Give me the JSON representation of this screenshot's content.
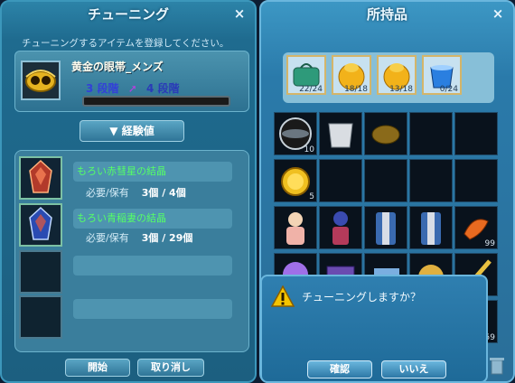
{
  "tuning": {
    "title": "チューニング",
    "close": "×",
    "instruction": "チューニングするアイテムを登録してください。",
    "item": {
      "name": "黄金の眼帯_メンズ",
      "stage_from": "3 段階",
      "stage_to": "4 段階",
      "progress": 0
    },
    "exp_button": "▼ 経験値",
    "materials": [
      {
        "name": "もろい赤彗星の結晶",
        "qty_label": "必要/保有",
        "qty": "3個 / 4個"
      },
      {
        "name": "もろい青稲妻の結晶",
        "qty_label": "必要/保有",
        "qty": "3個 / 29個"
      },
      {
        "name": "",
        "qty_label": "",
        "qty": ""
      },
      {
        "name": "",
        "qty_label": "",
        "qty": ""
      }
    ],
    "buttons": {
      "start": "開始",
      "cancel": "取り消し"
    }
  },
  "inventory": {
    "title": "所持品",
    "close": "×",
    "bags": [
      {
        "icon": "green-bag-icon",
        "count": "22/24"
      },
      {
        "icon": "yellow-bag-icon",
        "count": "18/18"
      },
      {
        "icon": "yellow-bag-icon",
        "count": "13/18"
      },
      {
        "icon": "blue-bucket-icon",
        "count": "0/24"
      }
    ],
    "slot_counts": {
      "r0c0": "10",
      "r1c0": "5",
      "r2c4": "99",
      "r4c4": "59"
    }
  },
  "dialog": {
    "message": "チューニングしますか？",
    "icon": "warning-icon",
    "confirm": "確認",
    "cancel": "いいえ"
  }
}
